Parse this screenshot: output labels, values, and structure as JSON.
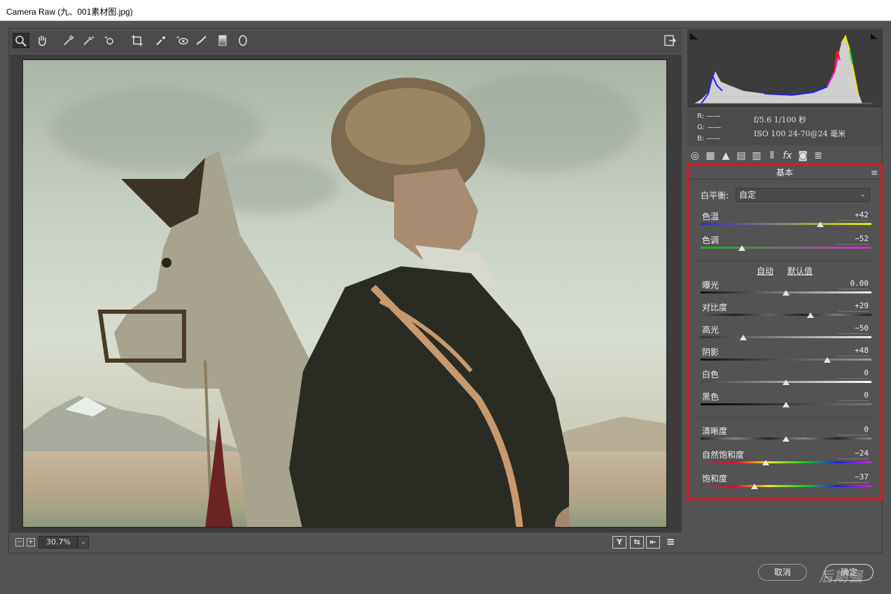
{
  "window": {
    "title": "Camera Raw (九、001素材图.jpg)"
  },
  "toolbar": {
    "tools": [
      "zoom-tool",
      "hand-tool",
      "white-balance-tool",
      "color-sampler-tool",
      "targeted-adjustment-tool",
      "crop-tool",
      "spot-removal-tool",
      "red-eye-tool",
      "adjustment-brush-tool",
      "graduated-filter-tool",
      "radial-filter-tool"
    ],
    "export_icon": "open-preferences-icon"
  },
  "zoom": {
    "minus": "−",
    "plus": "+",
    "value": "30.7%",
    "dropdown": "⌄"
  },
  "view_buttons": {
    "y": "Y",
    "swap": "⇆",
    "before_after": "⇤",
    "settings": "≡"
  },
  "info": {
    "r": "R: ——",
    "g": "G: ——",
    "b": "B: ——",
    "exif_line1": "f/5.6  1/100 秒",
    "exif_line2": "ISO 100  24-70@24 毫米"
  },
  "panel": {
    "title": "基本",
    "wb_label": "白平衡:",
    "wb_value": "自定",
    "auto": "自动",
    "defaults": "默认值",
    "sliders": [
      {
        "label": "色温",
        "value": "+42",
        "pos": 0.7
      },
      {
        "label": "色调",
        "value": "−52",
        "pos": 0.24
      },
      {
        "label": "曝光",
        "value": "0.00",
        "pos": 0.5
      },
      {
        "label": "对比度",
        "value": "+29",
        "pos": 0.645
      },
      {
        "label": "高光",
        "value": "−50",
        "pos": 0.25
      },
      {
        "label": "阴影",
        "value": "+48",
        "pos": 0.74
      },
      {
        "label": "白色",
        "value": "0",
        "pos": 0.5
      },
      {
        "label": "黑色",
        "value": "0",
        "pos": 0.5
      },
      {
        "label": "清晰度",
        "value": "0",
        "pos": 0.5
      },
      {
        "label": "自然饱和度",
        "value": "−24",
        "pos": 0.38
      },
      {
        "label": "饱和度",
        "value": "−37",
        "pos": 0.315
      }
    ]
  },
  "buttons": {
    "cancel": "取消",
    "ok": "确定"
  },
  "watermark": "后期强",
  "colors": {
    "highlight_border": "#e3151b",
    "panel_bg": "#535353"
  }
}
